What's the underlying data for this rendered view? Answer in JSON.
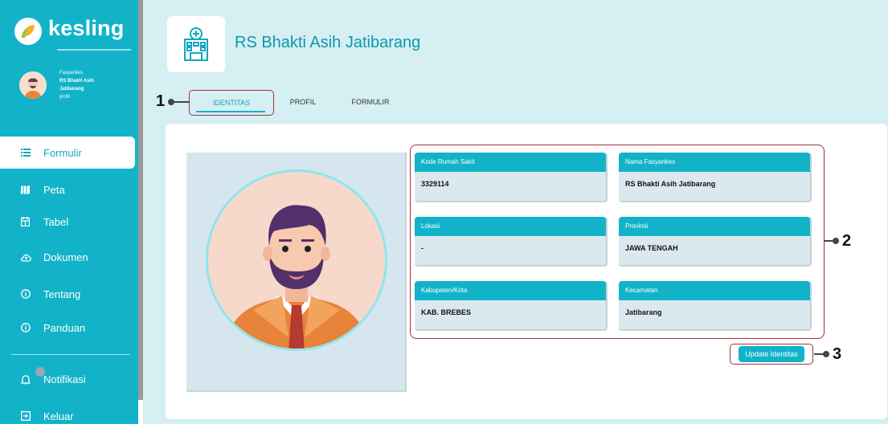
{
  "app": {
    "name": "kesling"
  },
  "user": {
    "role": "Fasyankes",
    "name": "RS Bhakti Asih Jatibarang",
    "link": "profil"
  },
  "menu": {
    "items": [
      {
        "label": "Formulir",
        "icon": "list-icon"
      },
      {
        "label": "Peta",
        "icon": "map-icon"
      },
      {
        "label": "Tabel",
        "icon": "table-icon"
      },
      {
        "label": "Dokumen",
        "icon": "cloud-icon"
      },
      {
        "label": "Tentang",
        "icon": "info-icon"
      },
      {
        "label": "Panduan",
        "icon": "info-icon"
      },
      {
        "label": "Notifikasi",
        "icon": "bell-icon"
      },
      {
        "label": "Keluar",
        "icon": "logout-icon"
      }
    ],
    "notification_badge": ""
  },
  "header": {
    "title": "RS Bhakti Asih Jatibarang"
  },
  "tabs": [
    {
      "label": "IDENTITAS"
    },
    {
      "label": "PROFIL"
    },
    {
      "label": "FORMULIR"
    }
  ],
  "fields": [
    {
      "label": "Kode Rumah Sakit",
      "value": "3329114"
    },
    {
      "label": "Nama Fasyankes",
      "value": "RS Bhakti Asih Jatibarang"
    },
    {
      "label": "Lokasi",
      "value": "-"
    },
    {
      "label": "Provinsi",
      "value": "JAWA TENGAH"
    },
    {
      "label": "Kabupaten/Kota",
      "value": "KAB. BREBES"
    },
    {
      "label": "Kecamatan",
      "value": "Jatibarang"
    }
  ],
  "buttons": {
    "update": "Update Identitas"
  },
  "callouts": [
    "1",
    "2",
    "3"
  ],
  "colors": {
    "accent": "#12b3c9",
    "highlight": "#a13437",
    "background": "#d5eff3"
  }
}
